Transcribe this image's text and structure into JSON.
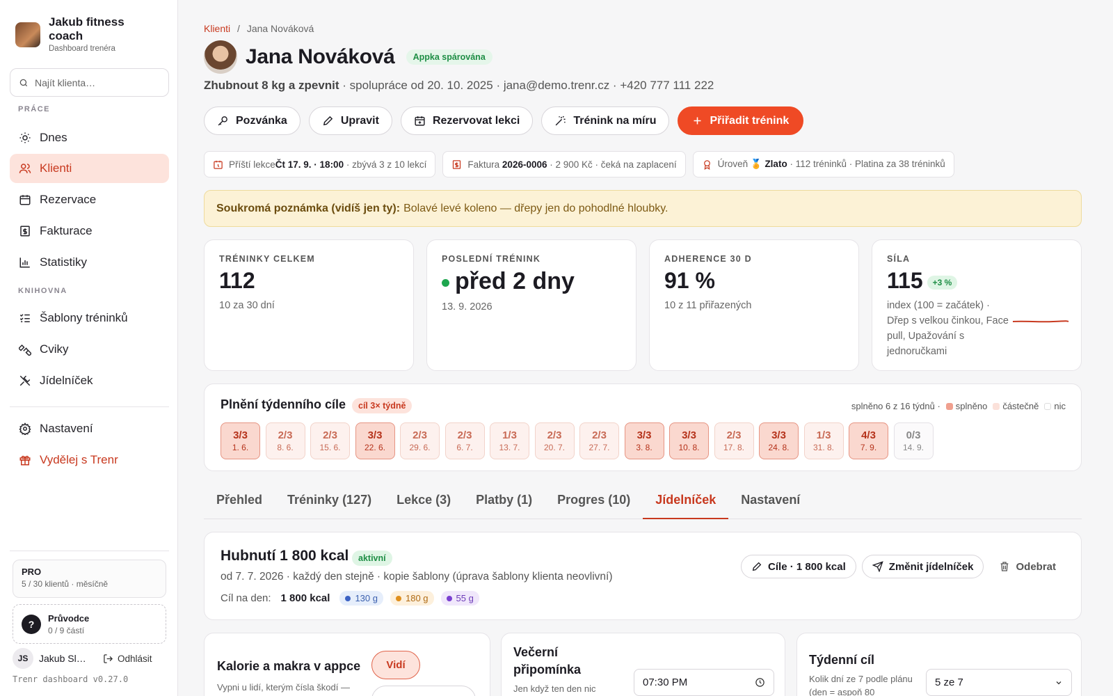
{
  "sidebar": {
    "brand_name": "Jakub fitness coach",
    "brand_sub": "Dashboard trenéra",
    "search_placeholder": "Najít klienta…",
    "section_work": "PRÁCE",
    "section_library": "KNIHOVNA",
    "items": [
      {
        "label": "Dnes",
        "icon": "sun-icon"
      },
      {
        "label": "Klienti",
        "icon": "users-icon"
      },
      {
        "label": "Rezervace",
        "icon": "calendar-icon"
      },
      {
        "label": "Fakturace",
        "icon": "invoice-icon"
      },
      {
        "label": "Statistiky",
        "icon": "bar-chart-icon"
      },
      {
        "label": "Šablony tréninků",
        "icon": "checklist-icon"
      },
      {
        "label": "Cviky",
        "icon": "dumbbell-icon"
      },
      {
        "label": "Jídelníček",
        "icon": "utensils-icon"
      },
      {
        "label": "Nastavení",
        "icon": "gear-icon"
      },
      {
        "label": "Vydělej s Trenr",
        "icon": "gift-icon"
      }
    ],
    "plan_title": "PRO",
    "plan_sub": "5 / 30 klientů · měsíčně",
    "guide_title": "Průvodce",
    "guide_sub": "0 / 9 částí",
    "user_initials": "JS",
    "user_name": "Jakub Sl…",
    "logout": "Odhlásit",
    "version": "Trenr dashboard v0.27.0"
  },
  "breadcrumb": {
    "parent": "Klienti",
    "sep": "/",
    "current": "Jana Nováková"
  },
  "client": {
    "name": "Jana Nováková",
    "status": "Appka spárována",
    "goal": "Zhubnout 8 kg a zpevnit",
    "meta": " · spolupráce od 20. 10. 2025 · jana@demo.trenr.cz · +420 777 111 222"
  },
  "actions": {
    "invite": "Pozvánka",
    "edit": "Upravit",
    "book": "Rezervovat lekci",
    "custom": "Trénink na míru",
    "assign": "Přiřadit trénink"
  },
  "chips": {
    "next_lesson_pre": "Příští lekce",
    "next_lesson_val": "Čt 17. 9. · 18:00",
    "next_lesson_post": " · zbývá 3 z 10 lekcí",
    "invoice_pre": "Faktura ",
    "invoice_val": "2026-0006",
    "invoice_post": " · 2 900 Kč · čeká na zaplacení",
    "level_pre": "Úroveň 🏅 ",
    "level_val": "Zlato",
    "level_post": " · 112 tréninků · Platina za 38 tréninků"
  },
  "note": {
    "label": "Soukromá poznámka (vidíš jen ty):",
    "text": "Bolavé levé koleno — dřepy jen do pohodlné hloubky."
  },
  "stats": {
    "total_label": "TRÉNINKY CELKEM",
    "total_value": "112",
    "total_sub": "10 za 30 dní",
    "last_label": "POSLEDNÍ TRÉNINK",
    "last_value": "před 2 dny",
    "last_sub": "13. 9. 2026",
    "adherence_label": "ADHERENCE 30 D",
    "adherence_value": "91 %",
    "adherence_sub": "10 z 11 přiřazených",
    "strength_label": "SÍLA",
    "strength_value": "115",
    "strength_change": "+3 %",
    "strength_sub": "index (100 = začátek) · Dřep s velkou činkou, Face pull, Upažování s jednoručkami",
    "strength_color": "#c8391f"
  },
  "weekly": {
    "title": "Plnění týdenního cíle",
    "badge": "cíl 3× týdně",
    "summary": "splněno 6 z 16 týdnů ·",
    "legend_full": "splněno",
    "legend_partial": "částečně",
    "legend_none": "nic",
    "weeks": [
      {
        "r": "3/3",
        "d": "1. 6.",
        "s": "full"
      },
      {
        "r": "2/3",
        "d": "8. 6.",
        "s": "part"
      },
      {
        "r": "2/3",
        "d": "15. 6.",
        "s": "part"
      },
      {
        "r": "3/3",
        "d": "22. 6.",
        "s": "full"
      },
      {
        "r": "2/3",
        "d": "29. 6.",
        "s": "part"
      },
      {
        "r": "2/3",
        "d": "6. 7.",
        "s": "part"
      },
      {
        "r": "1/3",
        "d": "13. 7.",
        "s": "part"
      },
      {
        "r": "2/3",
        "d": "20. 7.",
        "s": "part"
      },
      {
        "r": "2/3",
        "d": "27. 7.",
        "s": "part"
      },
      {
        "r": "3/3",
        "d": "3. 8.",
        "s": "full"
      },
      {
        "r": "3/3",
        "d": "10. 8.",
        "s": "full"
      },
      {
        "r": "2/3",
        "d": "17. 8.",
        "s": "part"
      },
      {
        "r": "3/3",
        "d": "24. 8.",
        "s": "full"
      },
      {
        "r": "1/3",
        "d": "31. 8.",
        "s": "part"
      },
      {
        "r": "4/3",
        "d": "7. 9.",
        "s": "full"
      },
      {
        "r": "0/3",
        "d": "14. 9.",
        "s": "none"
      }
    ]
  },
  "tabs": [
    "Přehled",
    "Tréninky (127)",
    "Lekce (3)",
    "Platby (1)",
    "Progres (10)",
    "Jídelníček",
    "Nastavení"
  ],
  "plan": {
    "title": "Hubnutí 1 800 kcal",
    "status": "aktivní",
    "sub": "od 7. 7. 2026 · každý den stejně · kopie šablony (úprava šablony klienta neovlivní)",
    "goal_label": "Cíl na den:",
    "goal_kcal": "1 800 kcal",
    "protein": "130 g",
    "carbs": "180 g",
    "fat": "55 g",
    "btn_goals": "Cíle · 1 800 kcal",
    "btn_change": "Změnit jídelníček",
    "btn_remove": "Odebrat"
  },
  "cards": {
    "macros_title": "Kalorie a makra v appce",
    "macros_sub": "Vypni u lidí, kterým čísla škodí —",
    "macros_toggle": "Vidí",
    "reminder_title": "Večerní připomínka",
    "reminder_sub": "Jen když ten den nic",
    "reminder_time": "07:30 PM",
    "weekly_title": "Týdenní cíl",
    "weekly_sub": "Kolik dní ze 7 podle plánu (den = aspoň 80",
    "weekly_select": "5 ze 7"
  }
}
